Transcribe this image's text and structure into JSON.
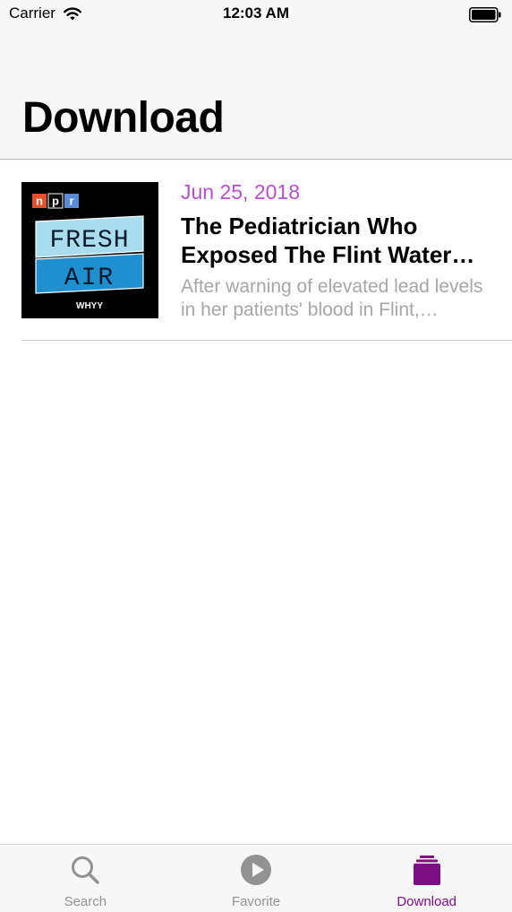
{
  "status_bar": {
    "carrier": "Carrier",
    "time": "12:03 AM"
  },
  "header": {
    "title": "Download"
  },
  "episodes": [
    {
      "date": "Jun 25, 2018",
      "title": "The Pediatrician Who Exposed The Flint Water Crisis",
      "description": "After warning of elevated lead levels in her patients' blood in Flint, Michigan",
      "artwork": {
        "npr_letters": [
          "n",
          "p",
          "r"
        ],
        "line1": "FRESH",
        "line2": "AIR",
        "station": "WHYY"
      }
    }
  ],
  "tab_bar": {
    "tabs": [
      {
        "label": "Search",
        "icon": "search-icon"
      },
      {
        "label": "Favorite",
        "icon": "play-circle-icon"
      },
      {
        "label": "Download",
        "icon": "download-stack-icon"
      }
    ],
    "active": "Download"
  },
  "colors": {
    "accent_purple": "#7d0f84",
    "date_purple": "#b452c9",
    "inactive_gray": "#929292"
  }
}
